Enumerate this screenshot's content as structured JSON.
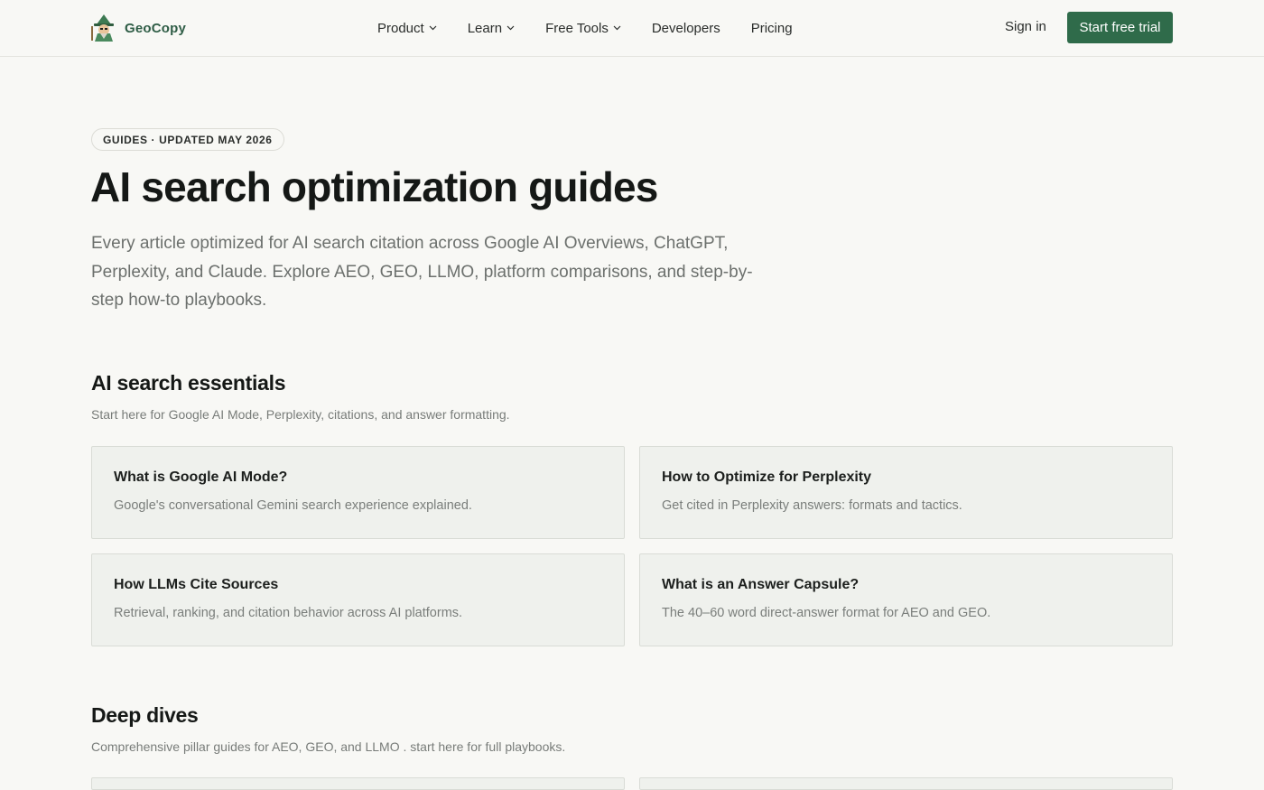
{
  "header": {
    "brand": "GeoCopy",
    "nav": [
      {
        "label": "Product",
        "dropdown": true
      },
      {
        "label": "Learn",
        "dropdown": true
      },
      {
        "label": "Free Tools",
        "dropdown": true
      },
      {
        "label": "Developers",
        "dropdown": false
      },
      {
        "label": "Pricing",
        "dropdown": false
      }
    ],
    "sign_in": "Sign in",
    "cta": "Start free trial"
  },
  "hero": {
    "badge": "GUIDES · UPDATED MAY 2026",
    "title": "AI search optimization guides",
    "description": "Every article optimized for AI search citation across Google AI Overviews, ChatGPT, Perplexity, and Claude. Explore AEO, GEO, LLMO, platform comparisons, and step-by-step how-to playbooks."
  },
  "sections": [
    {
      "title": "AI search essentials",
      "subtitle": "Start here for Google AI Mode, Perplexity, citations, and answer formatting.",
      "cards": [
        {
          "title": "What is Google AI Mode?",
          "desc": "Google's conversational Gemini search experience explained."
        },
        {
          "title": "How to Optimize for Perplexity",
          "desc": "Get cited in Perplexity answers: formats and tactics."
        },
        {
          "title": "How LLMs Cite Sources",
          "desc": "Retrieval, ranking, and citation behavior across AI platforms."
        },
        {
          "title": "What is an Answer Capsule?",
          "desc": "The 40–60 word direct-answer format for AEO and GEO."
        }
      ]
    },
    {
      "title": "Deep dives",
      "subtitle": "Comprehensive pillar guides for AEO, GEO, and LLMO . start here for full playbooks."
    }
  ],
  "colors": {
    "background": "#f8f8f5",
    "brand_green": "#2f6b4a",
    "card_bg": "#eff1ed"
  },
  "icons": {
    "logo": "wizard-mascot-icon",
    "dropdown": "chevron-down-icon"
  }
}
